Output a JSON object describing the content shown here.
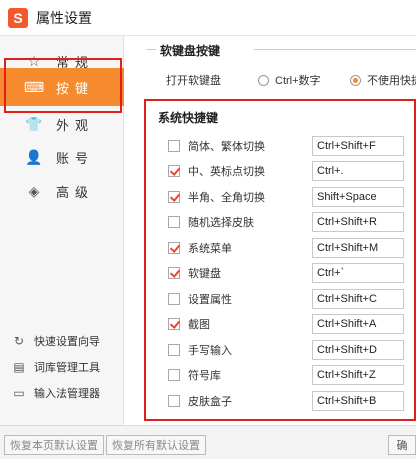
{
  "window": {
    "title": "属性设置",
    "logo_char": "S"
  },
  "sidebar": {
    "items": [
      {
        "label": "常规",
        "icon": "star-icon",
        "glyph": "☆"
      },
      {
        "label": "按键",
        "icon": "keyboard-icon",
        "glyph": "⌨"
      },
      {
        "label": "外观",
        "icon": "shirt-icon",
        "glyph": "👕"
      },
      {
        "label": "账号",
        "icon": "user-icon",
        "glyph": "👤"
      },
      {
        "label": "高级",
        "icon": "layers-icon",
        "glyph": "◈"
      }
    ],
    "active_index": 1,
    "tools": [
      {
        "label": "快速设置向导",
        "icon": "refresh-icon",
        "glyph": "↻"
      },
      {
        "label": "词库管理工具",
        "icon": "dictionary-icon",
        "glyph": "▤"
      },
      {
        "label": "输入法管理器",
        "icon": "monitor-icon",
        "glyph": "▭"
      }
    ]
  },
  "soft_keyboard": {
    "section_title": "软键盘按键",
    "label": "打开软键盘",
    "options": [
      {
        "label": "Ctrl+数字",
        "checked": false
      },
      {
        "label": "不使用快捷",
        "checked": true
      }
    ]
  },
  "hotkeys": {
    "section_title": "系统快捷键",
    "items": [
      {
        "label": "简体、繁体切换",
        "checked": false,
        "value": "Ctrl+Shift+F"
      },
      {
        "label": "中、英标点切换",
        "checked": true,
        "value": "Ctrl+."
      },
      {
        "label": "半角、全角切换",
        "checked": true,
        "value": "Shift+Space"
      },
      {
        "label": "随机选择皮肤",
        "checked": false,
        "value": "Ctrl+Shift+R"
      },
      {
        "label": "系统菜单",
        "checked": true,
        "value": "Ctrl+Shift+M"
      },
      {
        "label": "软键盘",
        "checked": true,
        "value": "Ctrl+`"
      },
      {
        "label": "设置属性",
        "checked": false,
        "value": "Ctrl+Shift+C"
      },
      {
        "label": "截图",
        "checked": true,
        "value": "Ctrl+Shift+A"
      },
      {
        "label": "手写输入",
        "checked": false,
        "value": "Ctrl+Shift+D"
      },
      {
        "label": "符号库",
        "checked": false,
        "value": "Ctrl+Shift+Z"
      },
      {
        "label": "皮肤盒子",
        "checked": false,
        "value": "Ctrl+Shift+B"
      }
    ]
  },
  "footer": {
    "restore_page_label": "恢复本页默认设置",
    "restore_all_label": "恢复所有默认设置",
    "right_button_label": "确"
  }
}
